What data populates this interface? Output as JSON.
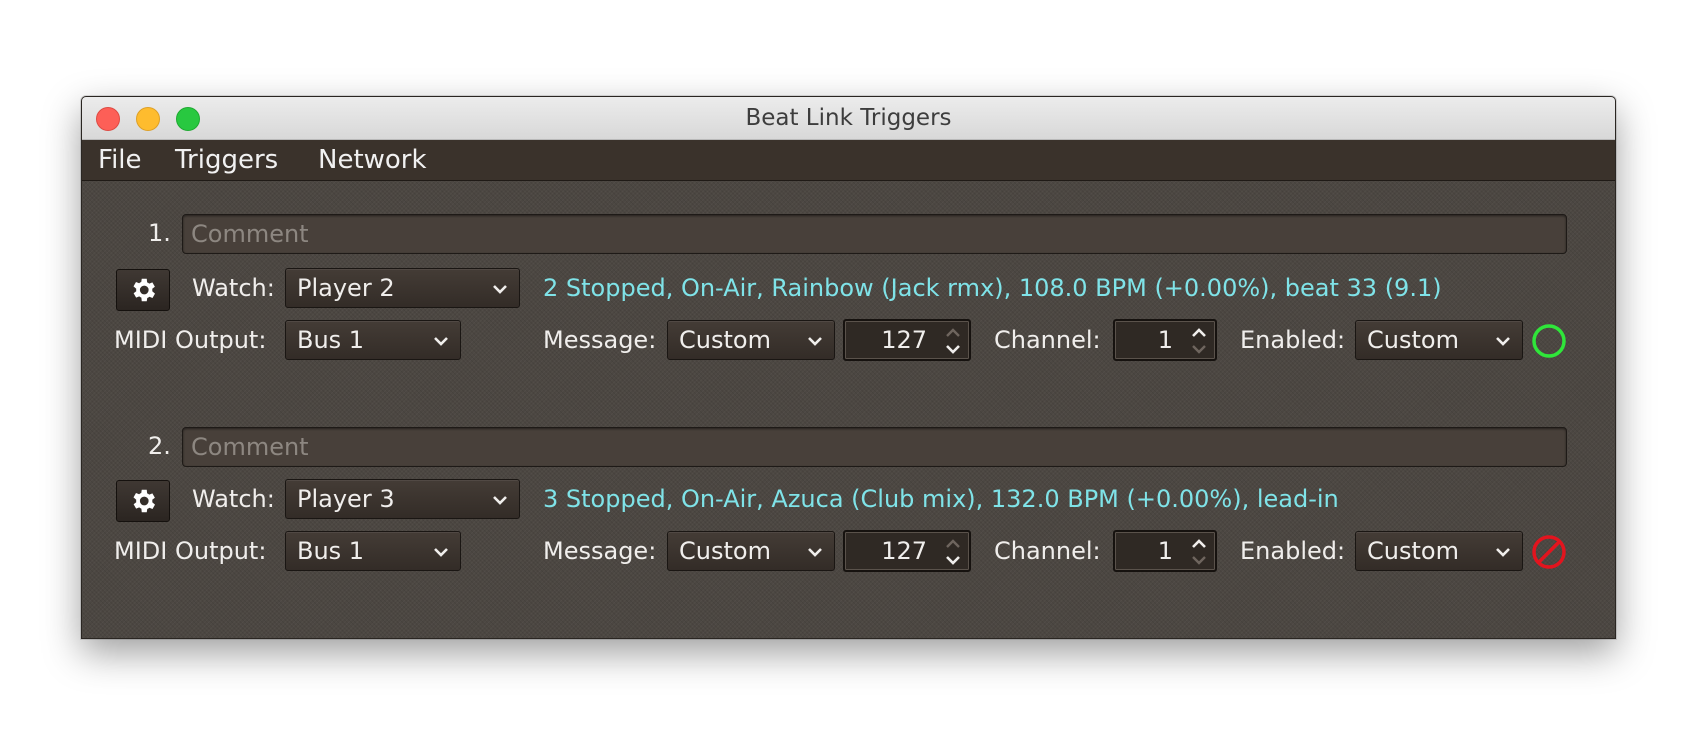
{
  "window": {
    "title": "Beat Link Triggers",
    "controls": [
      "close",
      "minimize",
      "zoom"
    ]
  },
  "menu": [
    "File",
    "Triggers",
    "Network"
  ],
  "labels": {
    "watch": "Watch:",
    "midi_output": "MIDI Output:",
    "message": "Message:",
    "channel": "Channel:",
    "enabled": "Enabled:",
    "comment_placeholder": "Comment"
  },
  "triggers": [
    {
      "index": "1.",
      "comment": "",
      "watch": "Player 2",
      "status": "2 Stopped, On-Air, Rainbow (Jack rmx), 108.0 BPM (+0.00%), beat 33 (9.1)",
      "midi_output": "Bus 1",
      "message": "Custom",
      "note": "127",
      "channel": "1",
      "enabled": "Custom",
      "indicator": "enabled",
      "indicator_color": "#2fe63a"
    },
    {
      "index": "2.",
      "comment": "",
      "watch": "Player 3",
      "status": "3 Stopped, On-Air, Azuca (Club mix), 132.0 BPM (+0.00%), lead-in",
      "midi_output": "Bus 1",
      "message": "Custom",
      "note": "127",
      "channel": "1",
      "enabled": "Custom",
      "indicator": "disabled",
      "indicator_color": "#e3141e"
    }
  ],
  "colors": {
    "status_text": "#7fe3e8",
    "background": "#4c4742",
    "menubar": "#3a322b"
  }
}
